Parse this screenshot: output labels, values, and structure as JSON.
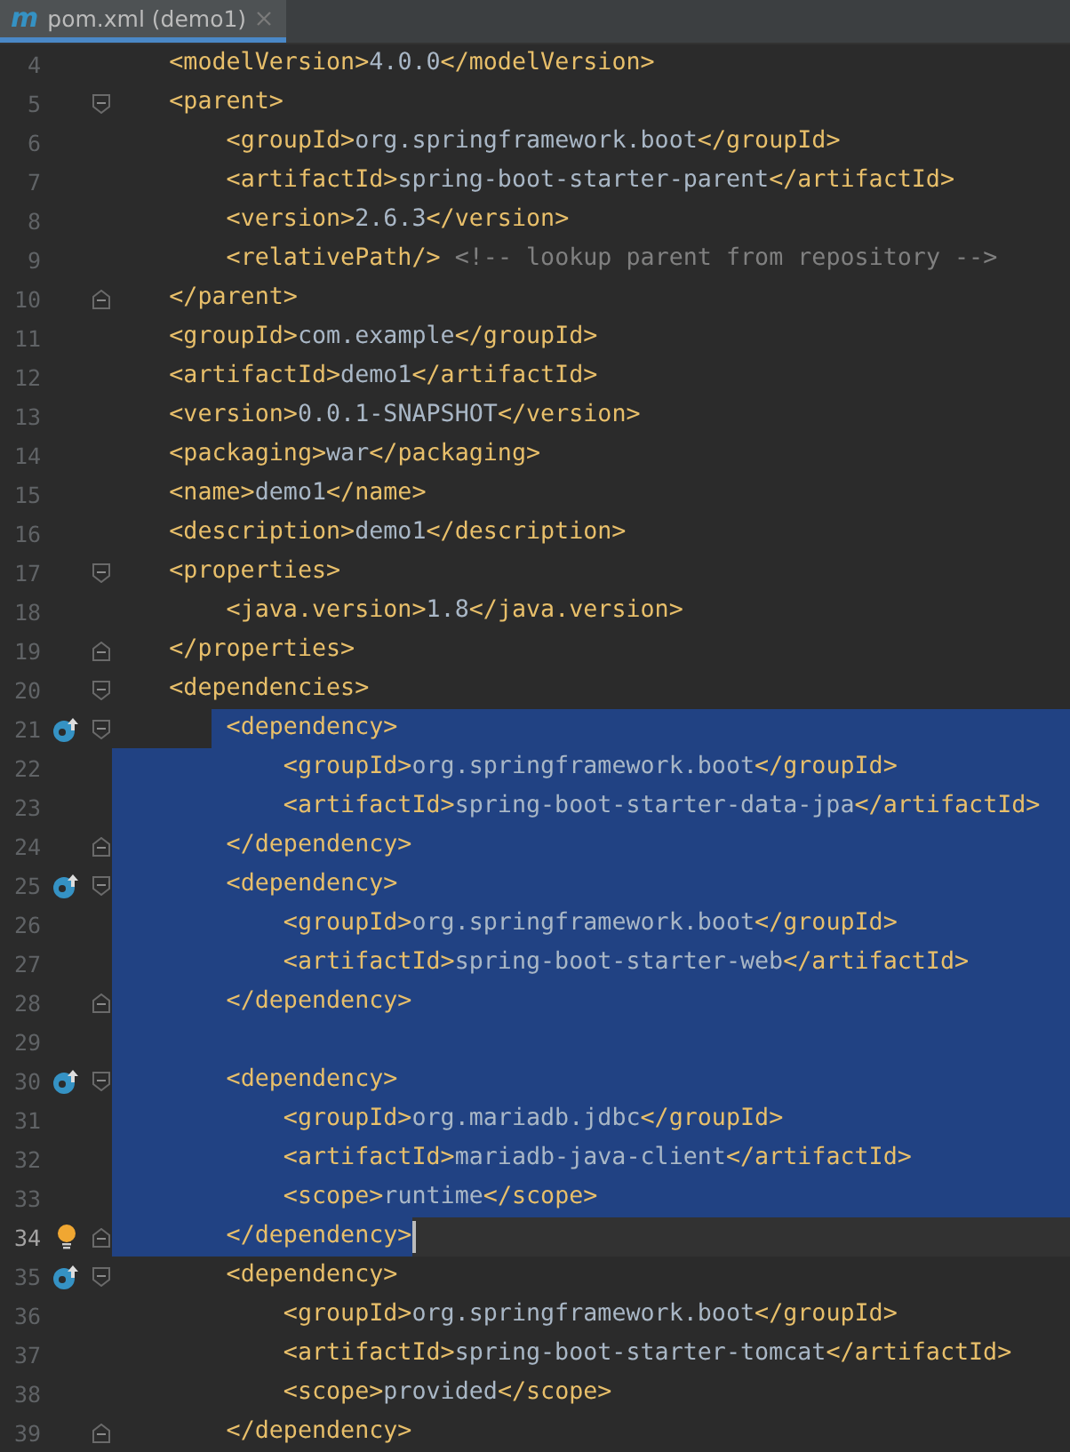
{
  "tab": {
    "icon": "m",
    "title": "pom.xml (demo1)",
    "selected": true
  },
  "lines": [
    {
      "number": "4",
      "kind": "plain",
      "text": "    <modelVersion>4.0.0</modelVersion>",
      "fold_start": false,
      "fold_end": false,
      "selected": false,
      "current": false
    },
    {
      "number": "5",
      "kind": "plain",
      "text": "    <parent>",
      "fold_start": true,
      "fold_end": false,
      "selected": false,
      "current": false
    },
    {
      "number": "6",
      "kind": "plain",
      "text": "        <groupId>org.springframework.boot</groupId>",
      "fold_start": false,
      "fold_end": false,
      "selected": false,
      "current": false
    },
    {
      "number": "7",
      "kind": "plain",
      "text": "        <artifactId>spring-boot-starter-parent</artifactId>",
      "fold_start": false,
      "fold_end": false,
      "selected": false,
      "current": false
    },
    {
      "number": "8",
      "kind": "plain",
      "text": "        <version>2.6.3</version>",
      "fold_start": false,
      "fold_end": false,
      "selected": false,
      "current": false
    },
    {
      "number": "9",
      "kind": "plain",
      "text": "        <relativePath/> <!-- lookup parent from repository -->",
      "fold_start": false,
      "fold_end": false,
      "selected": false,
      "current": false
    },
    {
      "number": "10",
      "kind": "plain",
      "text": "    </parent>",
      "fold_start": false,
      "fold_end": true,
      "selected": false,
      "current": false
    },
    {
      "number": "11",
      "kind": "plain",
      "text": "    <groupId>com.example</groupId>",
      "fold_start": false,
      "fold_end": false,
      "selected": false,
      "current": false
    },
    {
      "number": "12",
      "kind": "plain",
      "text": "    <artifactId>demo1</artifactId>",
      "fold_start": false,
      "fold_end": false,
      "selected": false,
      "current": false
    },
    {
      "number": "13",
      "kind": "plain",
      "text": "    <version>0.0.1-SNAPSHOT</version>",
      "fold_start": false,
      "fold_end": false,
      "selected": false,
      "current": false
    },
    {
      "number": "14",
      "kind": "plain",
      "text": "    <packaging>war</packaging>",
      "fold_start": false,
      "fold_end": false,
      "selected": false,
      "current": false
    },
    {
      "number": "15",
      "kind": "plain",
      "text": "    <name>demo1</name>",
      "fold_start": false,
      "fold_end": false,
      "selected": false,
      "current": false
    },
    {
      "number": "16",
      "kind": "plain",
      "text": "    <description>demo1</description>",
      "fold_start": false,
      "fold_end": false,
      "selected": false,
      "current": false
    },
    {
      "number": "17",
      "kind": "plain",
      "text": "    <properties>",
      "fold_start": true,
      "fold_end": false,
      "selected": false,
      "current": false
    },
    {
      "number": "18",
      "kind": "plain",
      "text": "        <java.version>1.8</java.version>",
      "fold_start": false,
      "fold_end": false,
      "selected": false,
      "current": false
    },
    {
      "number": "19",
      "kind": "plain",
      "text": "    </properties>",
      "fold_start": false,
      "fold_end": true,
      "selected": false,
      "current": false
    },
    {
      "number": "20",
      "kind": "plain",
      "text": "    <dependencies>",
      "fold_start": true,
      "fold_end": false,
      "selected": false,
      "current": false
    },
    {
      "number": "21",
      "kind": "override",
      "text": "        <dependency>",
      "fold_start": true,
      "fold_end": false,
      "selected": true,
      "current": false
    },
    {
      "number": "22",
      "kind": "plain",
      "text": "            <groupId>org.springframework.boot</groupId>",
      "fold_start": false,
      "fold_end": false,
      "selected": true,
      "current": false
    },
    {
      "number": "23",
      "kind": "plain",
      "text": "            <artifactId>spring-boot-starter-data-jpa</artifactId>",
      "fold_start": false,
      "fold_end": false,
      "selected": true,
      "current": false
    },
    {
      "number": "24",
      "kind": "plain",
      "text": "        </dependency>",
      "fold_start": false,
      "fold_end": true,
      "selected": true,
      "current": false
    },
    {
      "number": "25",
      "kind": "override",
      "text": "        <dependency>",
      "fold_start": true,
      "fold_end": false,
      "selected": true,
      "current": false
    },
    {
      "number": "26",
      "kind": "plain",
      "text": "            <groupId>org.springframework.boot</groupId>",
      "fold_start": false,
      "fold_end": false,
      "selected": true,
      "current": false
    },
    {
      "number": "27",
      "kind": "plain",
      "text": "            <artifactId>spring-boot-starter-web</artifactId>",
      "fold_start": false,
      "fold_end": false,
      "selected": true,
      "current": false
    },
    {
      "number": "28",
      "kind": "plain",
      "text": "        </dependency>",
      "fold_start": false,
      "fold_end": true,
      "selected": true,
      "current": false
    },
    {
      "number": "29",
      "kind": "plain",
      "fold_start": false,
      "fold_end": false,
      "selected": true,
      "current": false
    },
    {
      "number": "30",
      "kind": "override",
      "text": "        <dependency>",
      "fold_start": true,
      "fold_end": false,
      "selected": true,
      "current": false
    },
    {
      "number": "31",
      "kind": "plain",
      "text": "            <groupId>org.mariadb.jdbc</groupId>",
      "fold_start": false,
      "fold_end": false,
      "selected": true,
      "current": false
    },
    {
      "number": "32",
      "kind": "plain",
      "text": "            <artifactId>mariadb-java-client</artifactId>",
      "fold_start": false,
      "fold_end": false,
      "selected": true,
      "current": false
    },
    {
      "number": "33",
      "kind": "plain",
      "text": "            <scope>runtime</scope>",
      "fold_start": false,
      "fold_end": false,
      "selected": true,
      "current": false
    },
    {
      "number": "34",
      "kind": "bulb",
      "text": "        </dependency>",
      "fold_start": false,
      "fold_end": true,
      "selected": true,
      "current": true
    },
    {
      "number": "35",
      "kind": "override",
      "text": "        <dependency>",
      "fold_start": true,
      "fold_end": false,
      "selected": false,
      "current": false
    },
    {
      "number": "36",
      "kind": "plain",
      "text": "            <groupId>org.springframework.boot</groupId>",
      "fold_start": false,
      "fold_end": false,
      "selected": false,
      "current": false
    },
    {
      "number": "37",
      "kind": "plain",
      "text": "            <artifactId>spring-boot-starter-tomcat</artifactId>",
      "fold_start": false,
      "fold_end": false,
      "selected": false,
      "current": false
    },
    {
      "number": "38",
      "kind": "plain",
      "text": "            <scope>provided</scope>",
      "fold_start": false,
      "fold_end": false,
      "selected": false,
      "current": false
    },
    {
      "number": "39",
      "kind": "plain",
      "text": "        </dependency>",
      "fold_start": false,
      "fold_end": true,
      "selected": false,
      "current": false
    }
  ]
}
